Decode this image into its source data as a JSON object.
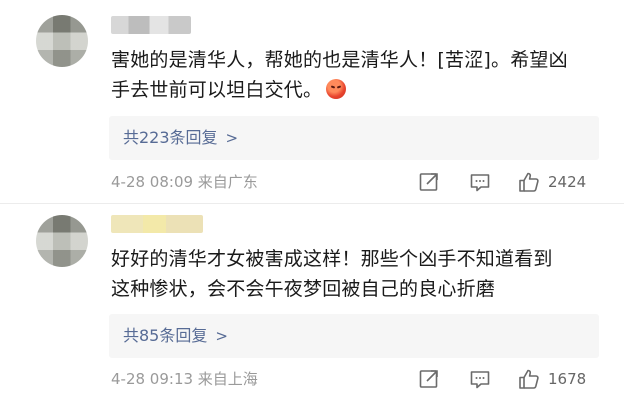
{
  "comments": [
    {
      "text_line1": "害她的是清华人，帮她的也是清华人！[苦涩]。希望凶",
      "text_line2": "手去世前可以坦白交代。",
      "emoji_icon": "angry-face-emoji",
      "replies_label": "共223条回复",
      "replies_chevron": ">",
      "meta": "4-28 08:09  来自广东",
      "like_count": "2424"
    },
    {
      "text_line1": "好好的清华才女被害成这样！那些个凶手不知道看到",
      "text_line2": "这种惨状，会不会午夜梦回被自己的良心折磨",
      "replies_label": "共85条回复",
      "replies_chevron": ">",
      "meta": "4-28 09:13  来自上海",
      "like_count": "1678"
    }
  ],
  "colors": {
    "link": "#576b95",
    "meta": "#9a9a9a",
    "reply_bg": "#f6f6f6"
  }
}
